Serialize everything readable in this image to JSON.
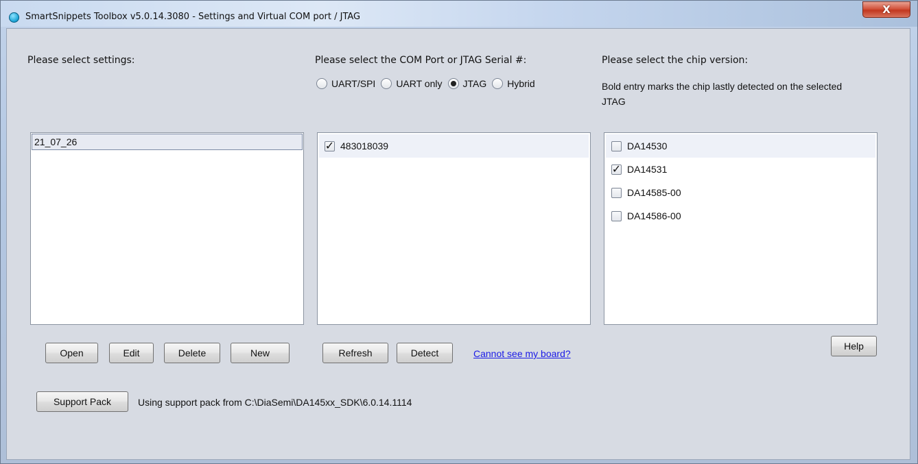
{
  "window": {
    "title": "SmartSnippets Toolbox v5.0.14.3080 - Settings and Virtual COM port / JTAG",
    "close_label": "X"
  },
  "settings": {
    "heading": "Please select settings:",
    "items": [
      "21_07_26"
    ],
    "buttons": {
      "open": "Open",
      "edit": "Edit",
      "delete": "Delete",
      "new": "New"
    }
  },
  "port": {
    "heading": "Please select the COM Port or JTAG Serial #:",
    "modes": [
      {
        "label": "UART/SPI",
        "selected": false
      },
      {
        "label": "UART only",
        "selected": false
      },
      {
        "label": "JTAG",
        "selected": true
      },
      {
        "label": "Hybrid",
        "selected": false
      }
    ],
    "items": [
      {
        "label": "483018039",
        "checked": true
      }
    ],
    "buttons": {
      "refresh": "Refresh",
      "detect": "Detect"
    },
    "help_link": "Cannot see my board?"
  },
  "chip": {
    "heading": "Please select the chip version:",
    "description": "Bold entry marks the chip lastly detected on the selected JTAG",
    "items": [
      {
        "label": "DA14530",
        "checked": false
      },
      {
        "label": "DA14531",
        "checked": true
      },
      {
        "label": "DA14585-00",
        "checked": false
      },
      {
        "label": "DA14586-00",
        "checked": false
      }
    ],
    "help_button": "Help"
  },
  "support": {
    "button": "Support Pack",
    "text": "Using support pack from C:\\DiaSemi\\DA145xx_SDK\\6.0.14.1114"
  },
  "colors": {
    "link": "#1a1ae6",
    "panel": "#d7dbe3",
    "titlebar": "#c9daf0"
  },
  "icons": {
    "app": "app-icon",
    "check": "check-icon"
  }
}
